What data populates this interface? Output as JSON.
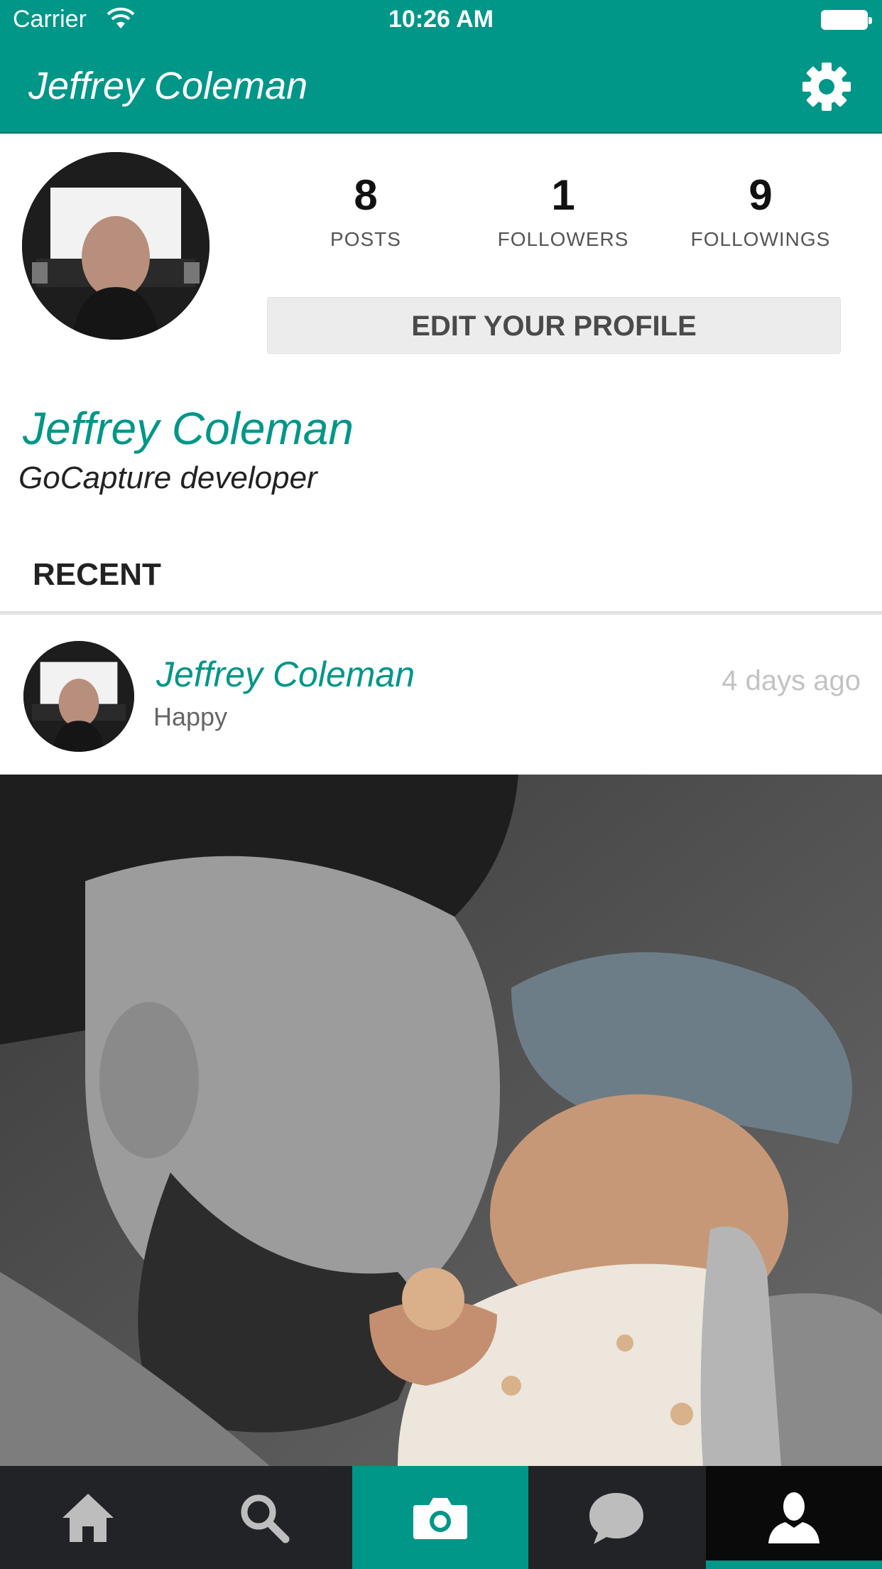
{
  "status_bar": {
    "carrier": "Carrier",
    "time": "10:26 AM"
  },
  "nav": {
    "title": "Jeffrey Coleman",
    "settings_icon": "gear-icon"
  },
  "profile": {
    "stats": [
      {
        "value": "8",
        "label": "POSTS"
      },
      {
        "value": "1",
        "label": "FOLLOWERS"
      },
      {
        "value": "9",
        "label": "FOLLOWINGS"
      }
    ],
    "edit_label": "EDIT YOUR PROFILE",
    "name": "Jeffrey Coleman",
    "bio": "GoCapture developer"
  },
  "recent": {
    "title": "RECENT",
    "post": {
      "author": "Jeffrey Coleman",
      "caption": "Happy",
      "time": "4 days ago"
    }
  },
  "tab_bar": {
    "items": [
      {
        "icon": "home-icon"
      },
      {
        "icon": "search-icon"
      },
      {
        "icon": "camera-icon"
      },
      {
        "icon": "chat-bubble-icon"
      },
      {
        "icon": "profile-icon",
        "selected": true
      }
    ]
  },
  "colors": {
    "accent": "#009688",
    "tab_bar": "#222327",
    "tab_selected": "#0a0a0a"
  }
}
